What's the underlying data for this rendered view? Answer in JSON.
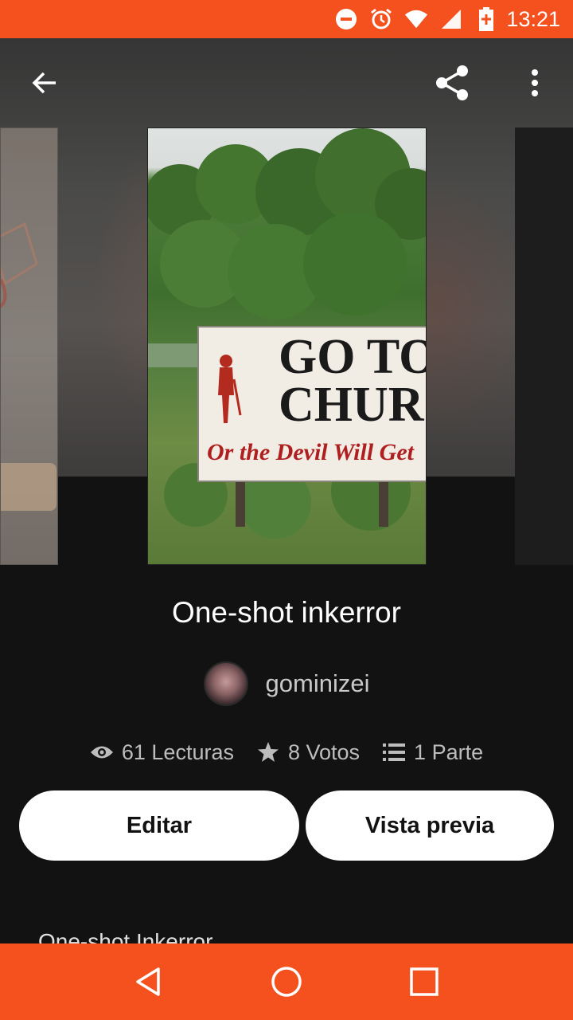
{
  "status_bar": {
    "time": "13:21",
    "icons": [
      "do-not-disturb-icon",
      "alarm-icon",
      "wifi-icon",
      "signal-icon",
      "battery-charging-icon"
    ]
  },
  "toolbar": {
    "back_icon": "arrow-left-icon",
    "share_icon": "share-icon",
    "more_icon": "more-vertical-icon"
  },
  "cover": {
    "sign_line1": "GO TO",
    "sign_line2": "CHURC",
    "sign_line3": "Or the Devil Will Get"
  },
  "story": {
    "title": "One-shot inkerror",
    "author": "gominizei"
  },
  "stats": {
    "reads": "61 Lecturas",
    "votes": "8 Votos",
    "parts": "1 Parte"
  },
  "actions": {
    "edit_label": "Editar",
    "preview_label": "Vista previa"
  },
  "parts_list": {
    "first_part_title": "One-shot Inkerror"
  },
  "nav": {
    "icons": [
      "back-triangle-icon",
      "home-circle-icon",
      "recents-square-icon"
    ]
  },
  "colors": {
    "accent": "#f4511e",
    "background": "#121212",
    "button_bg": "#ffffff"
  }
}
